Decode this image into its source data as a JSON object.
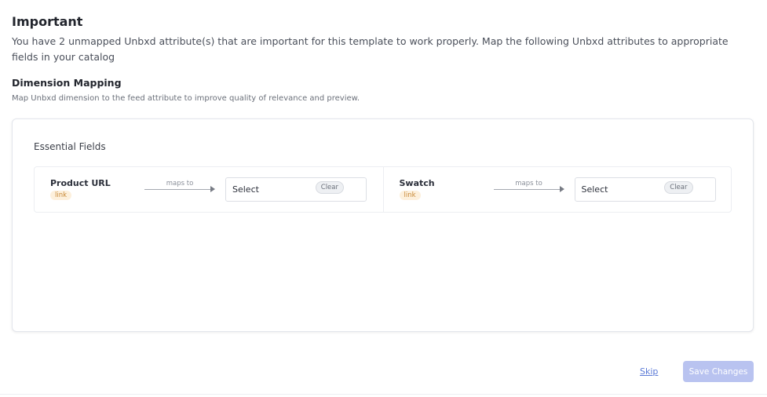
{
  "header": {
    "title": "Important",
    "description": "You have 2 unmapped Unbxd attribute(s) that are important for this template to work properly. Map the following Unbxd attributes to appropriate fields in your catalog"
  },
  "dimension_mapping": {
    "title": "Dimension Mapping",
    "subtitle": "Map Unbxd dimension to the feed attribute to improve quality of relevance and preview."
  },
  "essential_fields": {
    "title": "Essential Fields",
    "fields": [
      {
        "name": "Product URL",
        "type": "link",
        "maps_to_label": "maps to",
        "select_value": "Select",
        "clear_label": "Clear"
      },
      {
        "name": "Swatch",
        "type": "link",
        "maps_to_label": "maps to",
        "select_value": "Select",
        "clear_label": "Clear"
      }
    ]
  },
  "footer": {
    "skip_label": "Skip",
    "save_label": "Save Changes"
  },
  "colors": {
    "save_button_disabled": "#b9c3f0",
    "link": "#5b7ad6",
    "badge_bg": "#fdf0dc",
    "badge_text": "#c88a3a"
  }
}
